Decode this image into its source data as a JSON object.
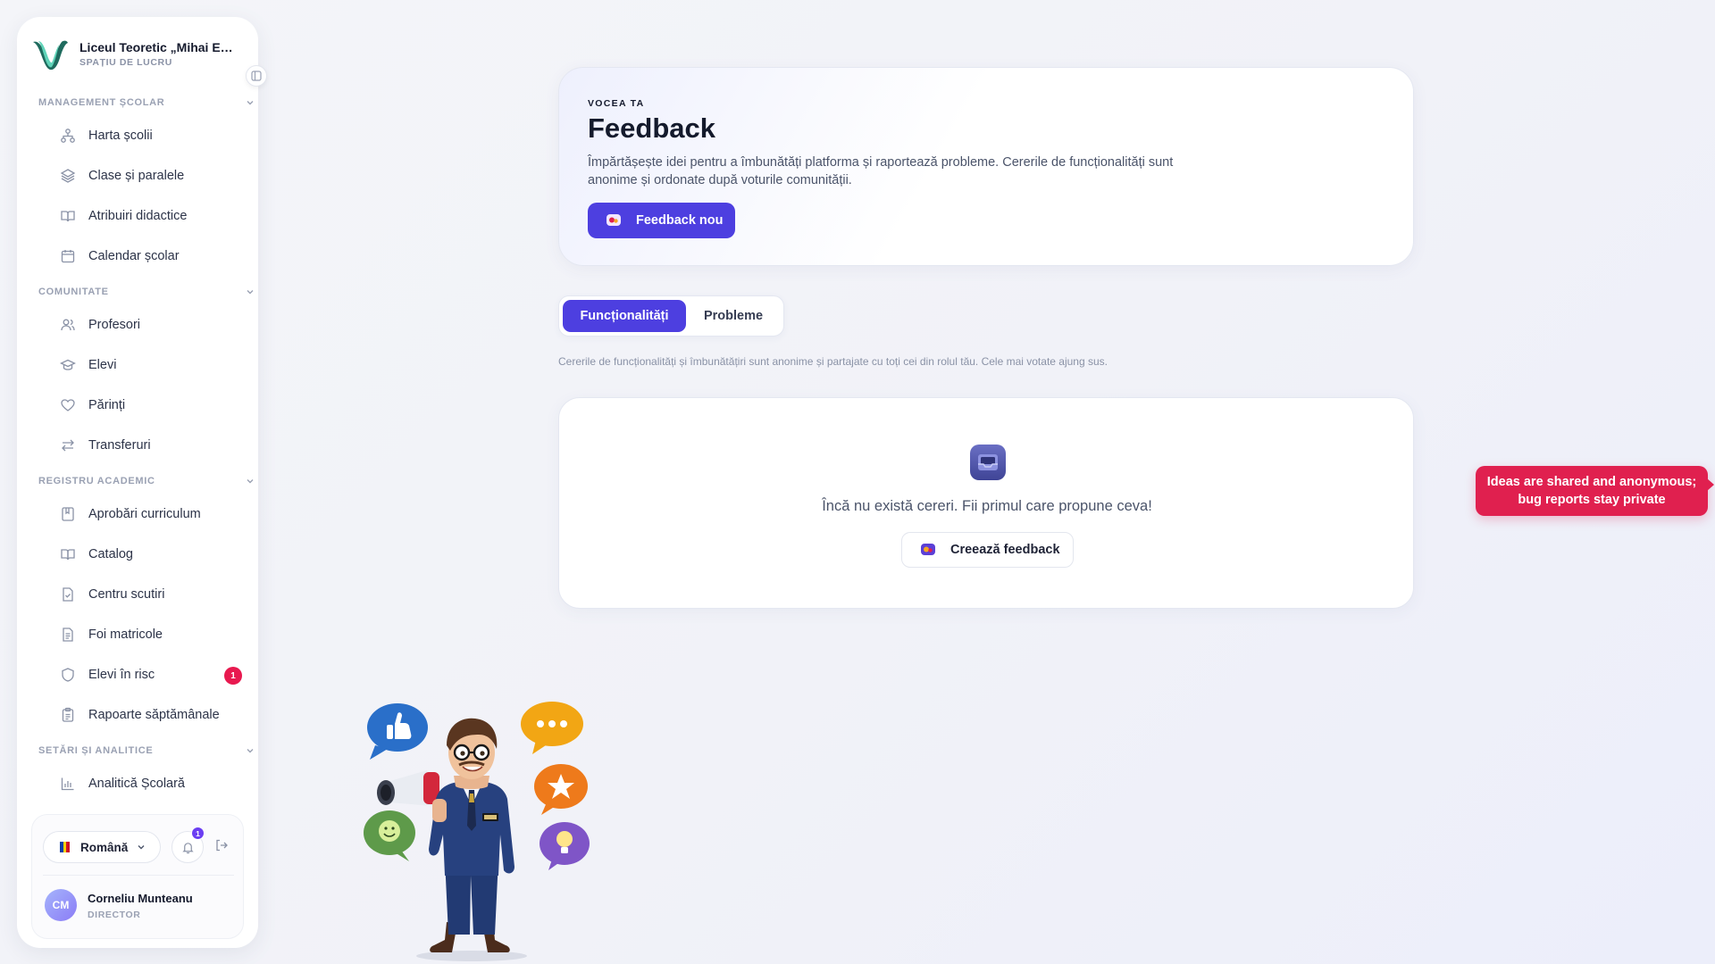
{
  "sidebar": {
    "school_name": "Liceul Teoretic „Mihai Eminescu”",
    "workspace_label": "SPAȚIU DE LUCRU",
    "sections": [
      {
        "title": "MANAGEMENT ȘCOLAR"
      },
      {
        "title": "COMUNITATE"
      },
      {
        "title": "REGISTRU ACADEMIC"
      },
      {
        "title": "SETĂRI ȘI ANALITICE"
      }
    ],
    "items": [
      {
        "label": "Harta școlii",
        "icon": "sitemap-icon"
      },
      {
        "label": "Clase și paralele",
        "icon": "layers-icon"
      },
      {
        "label": "Atribuiri didactice",
        "icon": "book-open-icon"
      },
      {
        "label": "Calendar școlar",
        "icon": "calendar-icon"
      },
      {
        "label": "Profesori",
        "icon": "users-icon"
      },
      {
        "label": "Elevi",
        "icon": "graduation-cap-icon"
      },
      {
        "label": "Părinți",
        "icon": "heart-icon"
      },
      {
        "label": "Transferuri",
        "icon": "arrows-swap-icon"
      },
      {
        "label": "Aprobări curriculum",
        "icon": "bookmark-book-icon"
      },
      {
        "label": "Catalog",
        "icon": "book-open-icon"
      },
      {
        "label": "Centru scutiri",
        "icon": "file-check-icon"
      },
      {
        "label": "Foi matricole",
        "icon": "file-text-icon"
      },
      {
        "label": "Elevi în risc",
        "icon": "shield-icon",
        "badge": "1"
      },
      {
        "label": "Rapoarte săptămânale",
        "icon": "clipboard-icon"
      },
      {
        "label": "Analitică Școlară",
        "icon": "bar-chart-icon"
      }
    ],
    "footer": {
      "language": "Română",
      "notifications_count": "1",
      "user_initials": "CM",
      "user_name": "Corneliu Munteanu",
      "user_role": "DIRECTOR"
    }
  },
  "hero": {
    "eyebrow": "VOCEA TA",
    "title": "Feedback",
    "description": "Împărtășește idei pentru a îmbunătăți platforma și raportează probleme. Cererile de funcționalități sunt anonime și ordonate după voturile comunității.",
    "new_button": "Feedback nou"
  },
  "tabs": [
    {
      "label": "Funcționalități",
      "active": true
    },
    {
      "label": "Probleme",
      "active": false
    }
  ],
  "tab_hint": "Cererile de funcționalități și îmbunătățiri sunt anonime și partajate cu toți cei din rolul tău. Cele mai votate ajung sus.",
  "empty_state": {
    "message": "Încă nu există cereri. Fii primul care propune ceva!",
    "create_button": "Creează feedback",
    "icon": "inbox-icon"
  },
  "tooltip": {
    "line1": "Ideas are shared and anonymous;",
    "line2": "bug reports stay private"
  },
  "colors": {
    "accent": "#4d3fe0",
    "danger": "#e0204f",
    "notification": "#6b3ef2"
  }
}
